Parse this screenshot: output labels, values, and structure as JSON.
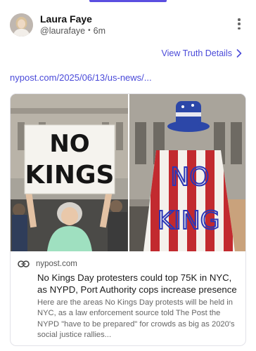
{
  "post": {
    "author_name": "Laura Faye",
    "author_handle": "@laurafaye",
    "time_ago": "6m",
    "separator": "•",
    "view_details": "View Truth Details",
    "link_text": "nypost.com/2025/06/13/us-news/..."
  },
  "card": {
    "domain": "nypost.com",
    "title": "No Kings Day protesters could top 75K in NYC, as NYPD, Port Authority cops increase presence",
    "description": "Here are the areas No Kings Day protests will be held in NYC, as a law enforcement source told The Post the NYPD \"have to be prepared\" for crowds as big as 2020's social justice rallies...",
    "image_left_sign": [
      "NO",
      "KINGS"
    ],
    "image_right_sign": [
      "NO",
      "KING"
    ]
  },
  "icons": {
    "more": "more-vertical-icon",
    "chevron": "chevron-right-icon",
    "link": "link-icon"
  },
  "colors": {
    "accent": "#4a4ad9",
    "indicator": "#5b4fe0"
  }
}
